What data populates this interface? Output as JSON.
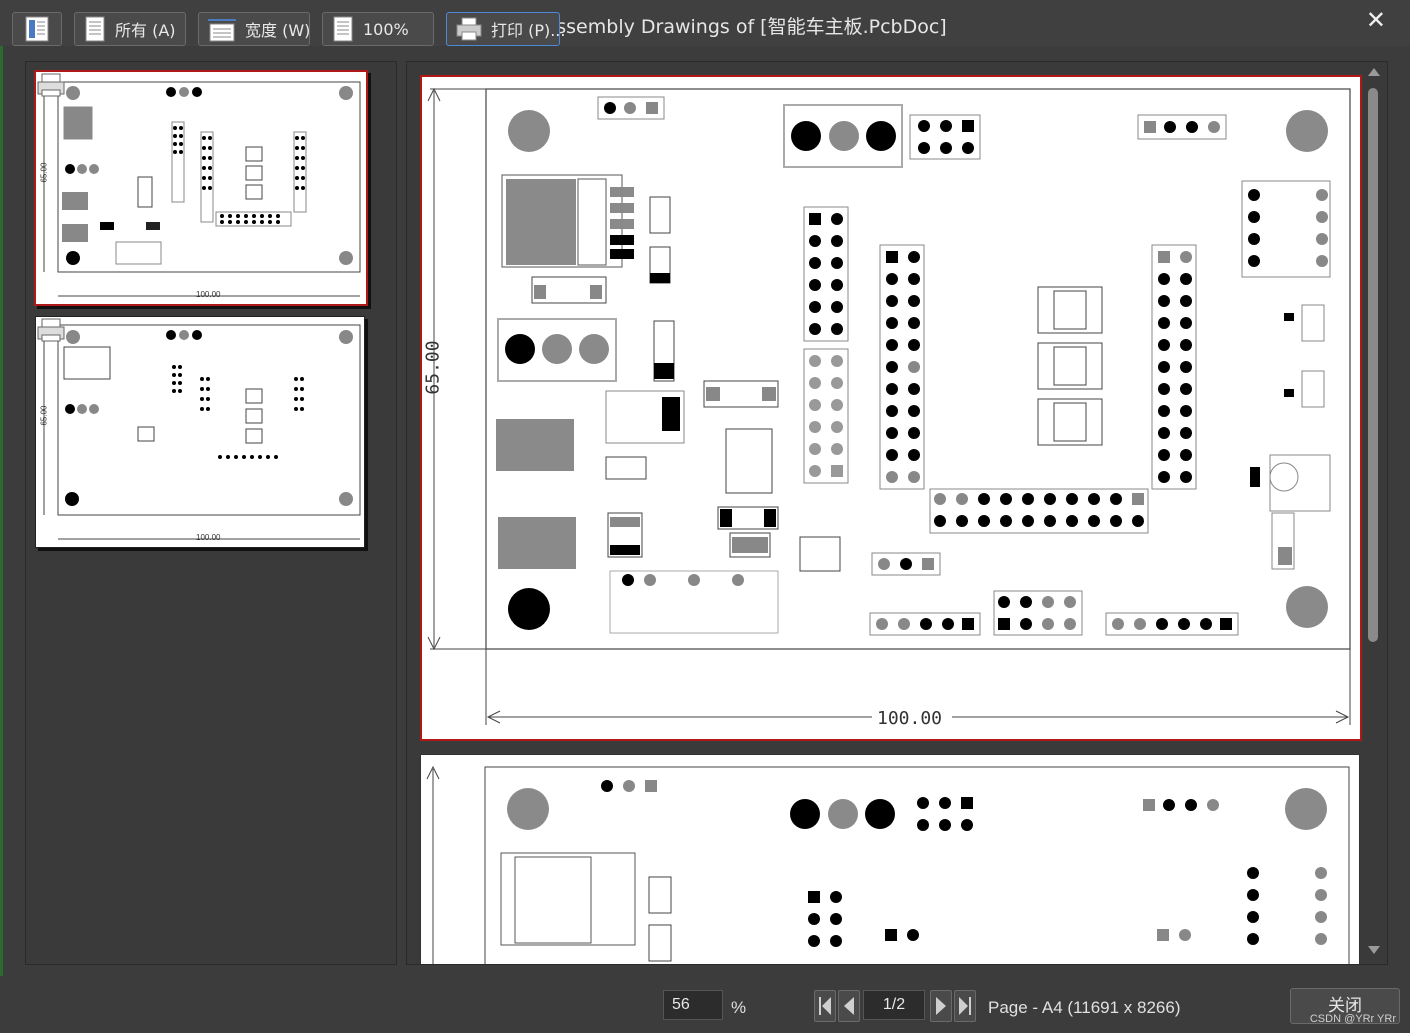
{
  "window": {
    "title": "Preview Assembly Drawings of [智能车主板.PcbDoc]",
    "close_glyph": "✕"
  },
  "thumbnails": [
    {
      "dim_h": "100.00",
      "dim_v": "65.00",
      "selected": true
    },
    {
      "dim_h": "100.00",
      "dim_v": "65.00",
      "selected": false
    }
  ],
  "preview": {
    "dim_h": "100.00",
    "dim_v": "65.00"
  },
  "toolbar": {
    "all_label": "所有 (A)",
    "width_label": "宽度 (W)",
    "zoom100_label": "100%",
    "print_label": "打印 (P)...",
    "zoom_value": "56",
    "zoom_unit": "%",
    "page_value": "1/2",
    "page_info": "Page - A4 (11691 x 8266)",
    "close_label": "关闭"
  },
  "watermark": "CSDN @YRr YRr",
  "colors": {
    "selection": "#b01818",
    "background": "#3c3c3c"
  }
}
